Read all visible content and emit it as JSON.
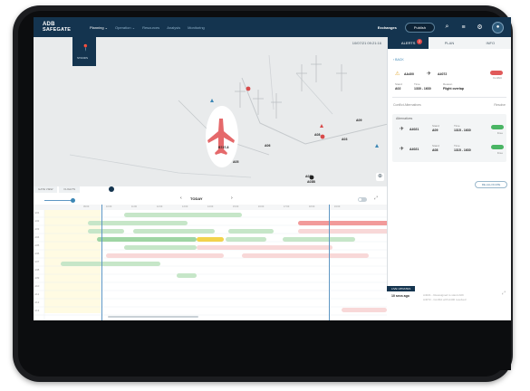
{
  "app": {
    "logo_line1": "ADB",
    "logo_line2": "SAFEGATE"
  },
  "nav": {
    "items": [
      {
        "label": "Planning ⌄",
        "active": true
      },
      {
        "label": "Operation ⌄",
        "active": false
      },
      {
        "label": "Resources",
        "active": false
      },
      {
        "label": "Analysis",
        "active": false
      },
      {
        "label": "Monitoring",
        "active": false
      }
    ]
  },
  "topbar": {
    "exchanges_label": "Exchanges",
    "publish_label": "Publish",
    "icons": [
      "search-icon",
      "list-icon",
      "gear-icon",
      "user-icon"
    ]
  },
  "map": {
    "datetime": "10/07/21   09:21:16",
    "stand_label": "STANDS",
    "aircraft_label": "B747-8",
    "stand_codes": [
      "A09",
      "A08",
      "A06",
      "A05",
      "A03",
      "A02",
      "A01",
      "A03B"
    ]
  },
  "right_panel": {
    "tabs": [
      {
        "label": "ALERTS",
        "active": true,
        "badge": "2"
      },
      {
        "label": "PLAN",
        "active": false
      },
      {
        "label": "INFO",
        "active": false
      }
    ],
    "back_label": "‹ BACK",
    "alert": {
      "code1": "AA400",
      "code2": "A4072",
      "status_text": "Conflict",
      "fields": [
        {
          "label": "Stand",
          "value": "A02"
        },
        {
          "label": "Time",
          "value": "1330 - 1630"
        },
        {
          "label": "Reason",
          "value": "Flight overlap"
        }
      ]
    },
    "section_left": "Conflict Alternatives",
    "section_right": "Resolve",
    "alternatives_title": "Alternatives",
    "alternatives": [
      {
        "reg": "A4021",
        "stand_label": "Stand",
        "stand": "A09",
        "time_label": "Time",
        "time": "1315 - 1630",
        "status": "Free"
      },
      {
        "reg": "A4021",
        "stand_label": "Stand",
        "stand": "A08",
        "time_label": "Time",
        "time": "1315 - 1630",
        "status": "Free"
      }
    ],
    "reassign_label": "RE-ALLOCATE"
  },
  "timeline": {
    "tabs": [
      "GATE VIEW",
      "FLIGHTS"
    ],
    "today_label": "TODAY",
    "hours": [
      "09:00",
      "10:00",
      "11:00",
      "12:00",
      "13:00",
      "14:00",
      "15:00",
      "16:00",
      "17:00",
      "18:00",
      "19:00"
    ],
    "rows": [
      "A01",
      "A02",
      "A03",
      "A04",
      "A05",
      "A06",
      "A07",
      "A08",
      "A09",
      "A10",
      "A11",
      "A12",
      "A13",
      "A14"
    ]
  },
  "live": {
    "tag": "LIVE UPDATES",
    "time": "10 secs ago",
    "msg1": "A4021 - Reassigned to stand A09",
    "msg2": "A4072 - Conflict with A400 resolved"
  }
}
